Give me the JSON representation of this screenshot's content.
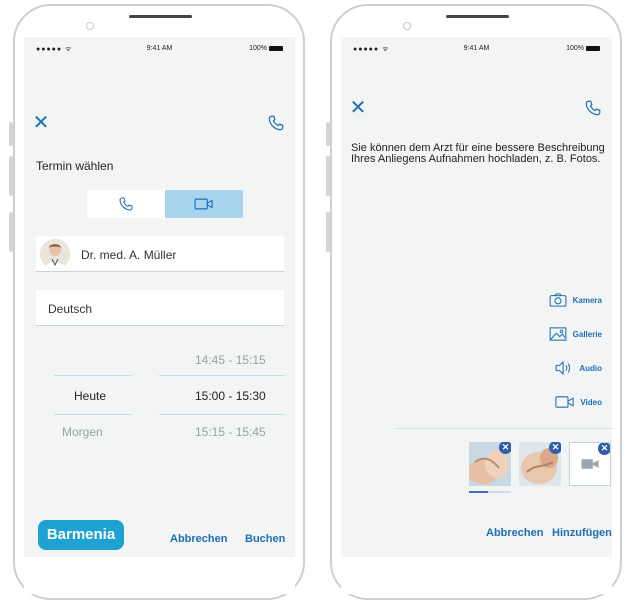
{
  "colors": {
    "accent": "#1e6fb8",
    "toggle_active": "#a9d4ee",
    "brand": "#1ea2d2"
  },
  "status_bar": {
    "signal": "●●●●● ᯤ",
    "time": "9:41 AM",
    "battery": "100%"
  },
  "left": {
    "close_icon": "close-icon",
    "call_icon": "phone-icon",
    "title": "Termin wählen",
    "toggle": {
      "audio_icon": "phone-icon",
      "video_icon": "video-camera-icon",
      "selected": "video"
    },
    "doctor": {
      "name": "Dr. med. A. Müller"
    },
    "language": {
      "value": "Deutsch"
    },
    "picker": {
      "days": [
        "Heute",
        "Morgen"
      ],
      "times": [
        "14:45 - 15:15",
        "15:00 - 15:30",
        "15:15 - 15:45"
      ],
      "selected_day": "Heute",
      "selected_time": "15:00 - 15:30"
    },
    "logo_text": "Barmenia",
    "cancel_label": "Abbrechen",
    "book_label": "Buchen"
  },
  "right": {
    "close_icon": "close-icon",
    "call_icon": "phone-icon",
    "description": "Sie können dem Arzt für eine bessere Beschreibung Ihres Anliegens Aufnahmen hochladen, z. B. Fotos.",
    "attach_options": [
      {
        "label": "Kamera",
        "icon": "camera-icon"
      },
      {
        "label": "Gallerie",
        "icon": "gallery-icon"
      },
      {
        "label": "Audio",
        "icon": "audio-icon"
      },
      {
        "label": "Video",
        "icon": "video-icon"
      }
    ],
    "thumbnails": [
      {
        "type": "photo",
        "remove_icon": "close-icon"
      },
      {
        "type": "photo",
        "remove_icon": "close-icon"
      },
      {
        "type": "video",
        "remove_icon": "close-icon"
      }
    ],
    "upload_progress": 0.45,
    "cancel_label": "Abbrechen",
    "add_label": "Hinzufügen"
  }
}
